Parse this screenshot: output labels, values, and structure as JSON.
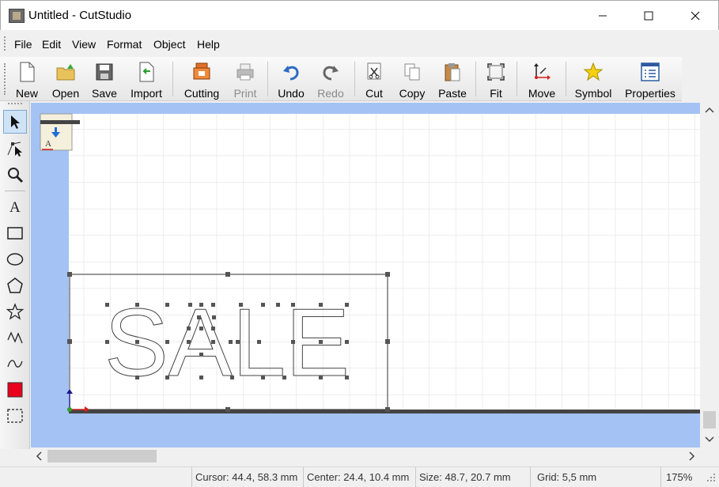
{
  "window": {
    "title": "Untitled - CutStudio"
  },
  "menu": [
    "File",
    "Edit",
    "View",
    "Format",
    "Object",
    "Help"
  ],
  "toolbar": {
    "new": "New",
    "open": "Open",
    "save": "Save",
    "import": "Import",
    "cutting": "Cutting",
    "print": "Print",
    "undo": "Undo",
    "redo": "Redo",
    "cut": "Cut",
    "copy": "Copy",
    "paste": "Paste",
    "fit": "Fit",
    "move": "Move",
    "symbol": "Symbol",
    "properties": "Properties"
  },
  "canvas": {
    "text_object": "SALE"
  },
  "status": {
    "cursor": "Cursor: 44.4, 58.3 mm",
    "center": "Center: 24.4, 10.4 mm",
    "size": "Size: 48.7, 20.7 mm",
    "grid": "Grid: 5,5 mm",
    "zoom": "175%"
  },
  "colors": {
    "media": "#a4c2f4",
    "fill_swatch": "#e8001c",
    "guide": "#444444"
  }
}
